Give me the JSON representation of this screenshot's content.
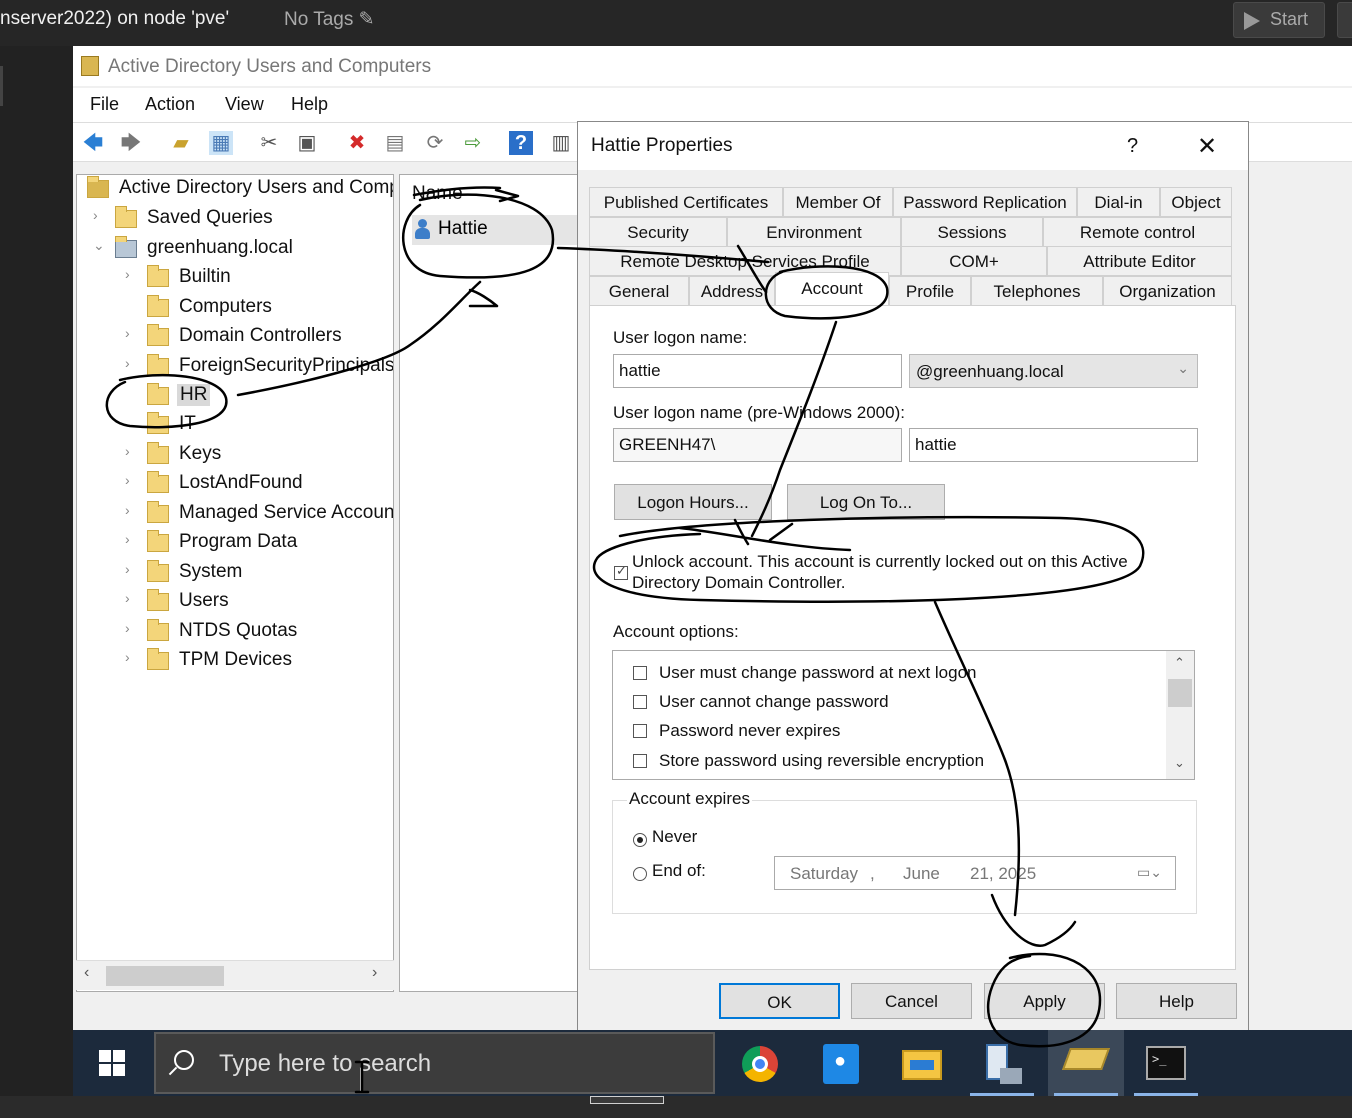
{
  "host": {
    "vm_title": "nserver2022) on node 'pve'",
    "tags_label": "No Tags",
    "start_button": "Start"
  },
  "app": {
    "title": "Active Directory Users and Computers",
    "menu": [
      "File",
      "Action",
      "View",
      "Help"
    ]
  },
  "tree": {
    "root": "Active Directory Users and Comp",
    "items": [
      {
        "label": "Saved Queries",
        "chev": "›"
      },
      {
        "label": "greenhuang.local",
        "chev": "⌄"
      },
      {
        "label": "Builtin",
        "chev": "›"
      },
      {
        "label": "Computers",
        "chev": ""
      },
      {
        "label": "Domain Controllers",
        "chev": "›"
      },
      {
        "label": "ForeignSecurityPrincipals",
        "chev": "›"
      },
      {
        "label": "HR",
        "chev": ""
      },
      {
        "label": "IT",
        "chev": ""
      },
      {
        "label": "Keys",
        "chev": "›"
      },
      {
        "label": "LostAndFound",
        "chev": "›"
      },
      {
        "label": "Managed Service Accoun",
        "chev": "›"
      },
      {
        "label": "Program Data",
        "chev": "›"
      },
      {
        "label": "System",
        "chev": "›"
      },
      {
        "label": "Users",
        "chev": "›"
      },
      {
        "label": "NTDS Quotas",
        "chev": "›"
      },
      {
        "label": "TPM Devices",
        "chev": "›"
      }
    ]
  },
  "list": {
    "column": "Name",
    "rows": [
      "Hattie"
    ]
  },
  "dialog": {
    "title": "Hattie Properties",
    "help_glyph": "?",
    "tabs_row1": [
      "Published Certificates",
      "Member Of",
      "Password Replication",
      "Dial-in",
      "Object"
    ],
    "tabs_row2": [
      "Security",
      "Environment",
      "Sessions",
      "Remote control"
    ],
    "tabs_row3": [
      "Remote Desktop Services Profile",
      "COM+",
      "Attribute Editor"
    ],
    "tabs_row4": [
      "General",
      "Address",
      "Account",
      "Profile",
      "Telephones",
      "Organization"
    ],
    "logon_label": "User logon name:",
    "logon_value": "hattie",
    "domain_value": "@greenhuang.local",
    "pre2000_label": "User logon name (pre-Windows 2000):",
    "pre2000_domain": "GREENH47\\",
    "pre2000_user": "hattie",
    "logon_hours": "Logon Hours...",
    "log_on_to": "Log On To...",
    "unlock_text_1": "Unlock account. This account is currently locked out on this Active",
    "unlock_text_2": "Directory Domain Controller.",
    "options_label": "Account options:",
    "options": [
      "User must change password at next logon",
      "User cannot change password",
      "Password never expires",
      "Store password using reversible encryption"
    ],
    "expires_label": "Account expires",
    "never_label": "Never",
    "endof_label": "End of:",
    "date": {
      "day": "Saturday",
      "sep": ",",
      "month": "June",
      "date": "21, 2025"
    },
    "buttons": {
      "ok": "OK",
      "cancel": "Cancel",
      "apply": "Apply",
      "help": "Help"
    }
  },
  "taskbar": {
    "search_placeholder": "Type here to search"
  }
}
